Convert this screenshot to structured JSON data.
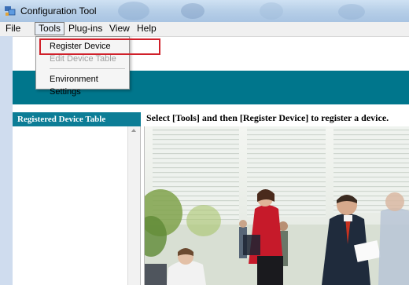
{
  "window": {
    "title": "Configuration Tool"
  },
  "menubar": {
    "items": [
      "File",
      "Tools",
      "Plug-ins",
      "View",
      "Help"
    ]
  },
  "tools_menu": {
    "items": [
      {
        "label": "Register Device",
        "enabled": true
      },
      {
        "label": "Edit Device Table",
        "enabled": false
      },
      {
        "label": "Environment Settings",
        "enabled": true
      }
    ]
  },
  "sidebar": {
    "header": "Registered Device Table"
  },
  "main": {
    "instruction": "Select [Tools] and then [Register Device] to register a device."
  },
  "colors": {
    "banner": "#00768c",
    "sidebar_header": "#0c7d96",
    "highlight": "#d0202a"
  }
}
